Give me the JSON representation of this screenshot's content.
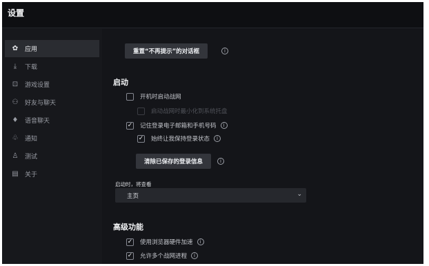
{
  "window": {
    "title": "设置"
  },
  "sidebar": {
    "items": [
      {
        "label": "应用",
        "icon": "gear-icon",
        "glyph": "✿",
        "active": true
      },
      {
        "label": "下载",
        "icon": "download-icon",
        "glyph": "⤓",
        "active": false
      },
      {
        "label": "游戏设置",
        "icon": "gamepad-icon",
        "glyph": "⊡",
        "active": false
      },
      {
        "label": "好友与聊天",
        "icon": "friends-icon",
        "glyph": "⚇",
        "active": false
      },
      {
        "label": "语音聊天",
        "icon": "microphone-icon",
        "glyph": "♦",
        "active": false
      },
      {
        "label": "通知",
        "icon": "bell-icon",
        "glyph": "♧",
        "active": false
      },
      {
        "label": "测试",
        "icon": "flask-icon",
        "glyph": "♙",
        "active": false
      },
      {
        "label": "关于",
        "icon": "document-icon",
        "glyph": "▤",
        "active": false
      }
    ]
  },
  "main": {
    "reset_dialogs_button": "重置“不再提示”的对话框",
    "startup": {
      "title": "启动",
      "launch_on_startup": "开机时启动战网",
      "launch_minimized": "启动战网时最小化到系统托盘",
      "remember_email": "记住登录电子邮箱和手机号码",
      "keep_logged_in": "始终让我保持登录状态",
      "clear_login_button": "清除已保存的登录信息",
      "on_launch_label": "启动时，将查看",
      "on_launch_value": "主页"
    },
    "advanced": {
      "title": "高级功能",
      "hardware_accel": "使用浏览器硬件加速",
      "multiple_instances": "允许多个战网进程"
    }
  }
}
